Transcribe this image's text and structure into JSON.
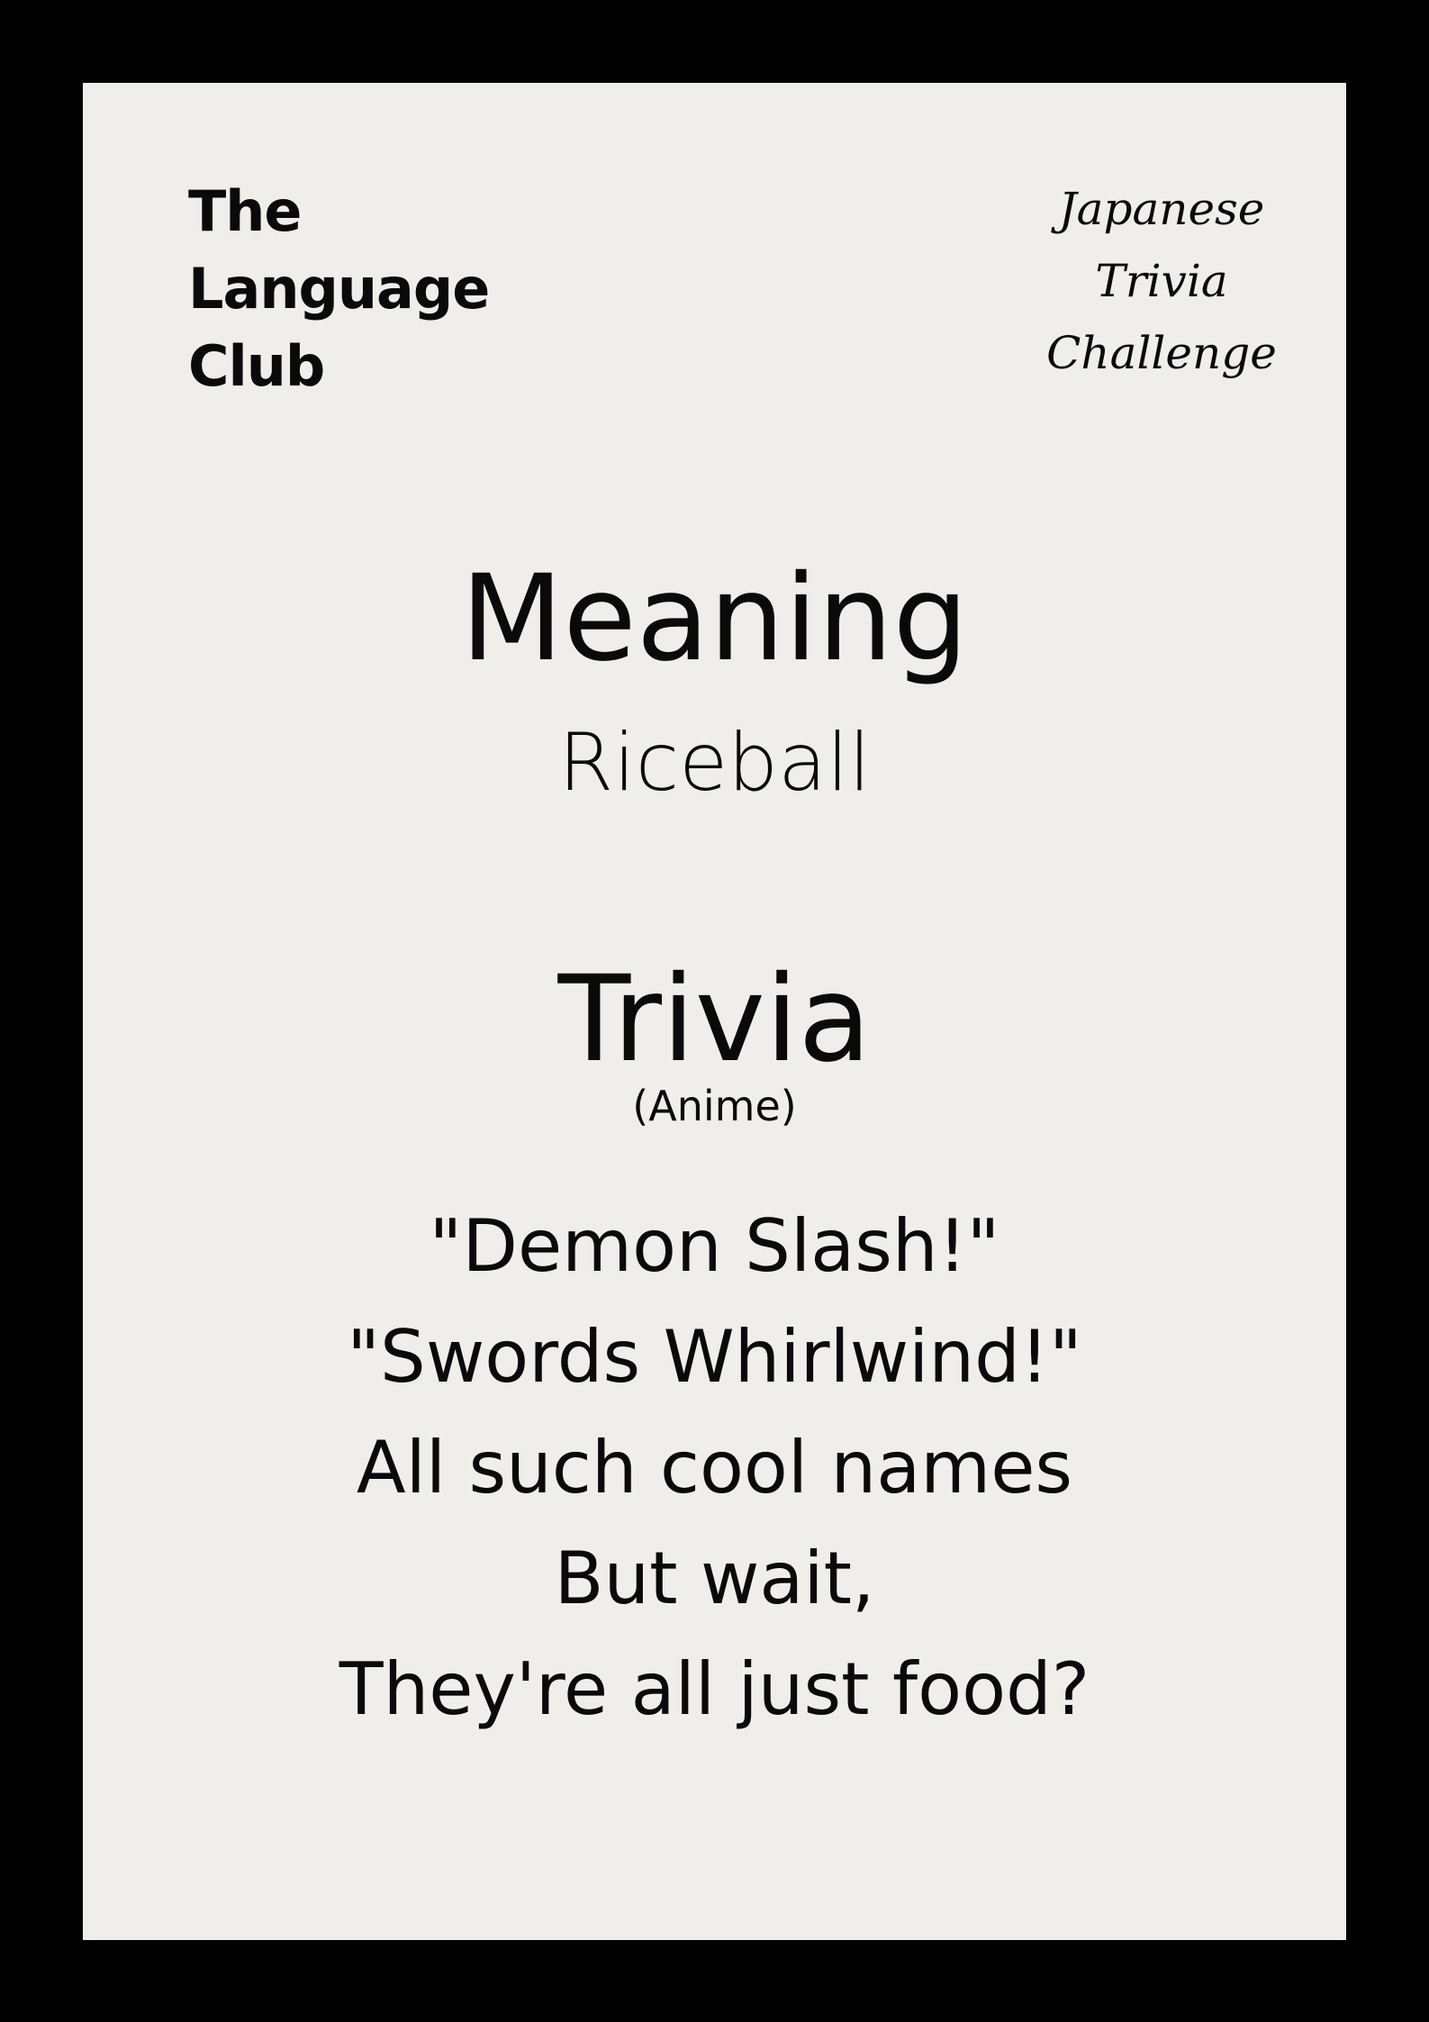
{
  "logo": {
    "lines": [
      "The",
      "Language",
      "Club"
    ]
  },
  "series_title": {
    "lines": [
      "Japanese",
      "Trivia",
      "Challenge"
    ]
  },
  "meaning": {
    "heading": "Meaning",
    "value": "Riceball"
  },
  "trivia": {
    "heading": "Trivia",
    "category": "(Anime)",
    "lines": [
      "\"Demon Slash!\"",
      "\"Swords Whirlwind!\"",
      "All such cool names",
      "But wait,",
      "They're all just food?"
    ]
  },
  "colors": {
    "background_frame": "#000000",
    "card": "#efeeea",
    "text": "#0a0a0a"
  }
}
